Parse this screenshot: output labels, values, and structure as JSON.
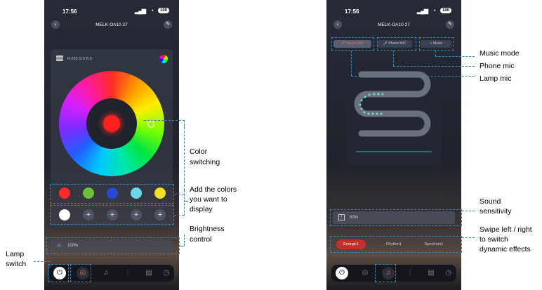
{
  "status": {
    "time": "17:56",
    "battery": "100"
  },
  "left": {
    "title": "MELK-OA10   27",
    "rgb_text": "R:255 G:0 B:0",
    "brightness": "100%",
    "swatches": [
      "#ff2a2a",
      "#6ac23a",
      "#2a48d8",
      "#6ad8e8",
      "#f2e02a"
    ],
    "custom_slots": [
      "#ffffff",
      "+",
      "+",
      "+",
      "+"
    ]
  },
  "right": {
    "title": "MELK-OA10   27",
    "mic_tabs": [
      "Device MIC",
      "Phone MIC",
      "Music"
    ],
    "sensitivity": "50%",
    "effects": [
      "Energic1",
      "Rhythm1",
      "Spectrum1"
    ]
  },
  "labels": {
    "color_switching": [
      "Color",
      "switching"
    ],
    "add_colors": [
      "Add the colors",
      "you want to",
      "display"
    ],
    "brightness": [
      "Brightness",
      "control"
    ],
    "lamp_switch": [
      "Lamp",
      "switch"
    ],
    "music_mode": "Music mode",
    "phone_mic": "Phone mic",
    "lamp_mic": "Lamp mic",
    "sound_sensitivity": [
      "Sound",
      "sensitivity"
    ],
    "swipe": [
      "Swipe left / right",
      "to switch",
      "dynamic effects"
    ]
  },
  "icons": [
    "back-icon",
    "edit-icon",
    "power-icon",
    "color-icon",
    "music-icon",
    "equalizer-icon",
    "scene-icon",
    "timer-icon",
    "sun-icon",
    "mic-icon"
  ],
  "colors": {
    "accent_dash": "#3a86b8",
    "energic_active": "#c0302e"
  }
}
